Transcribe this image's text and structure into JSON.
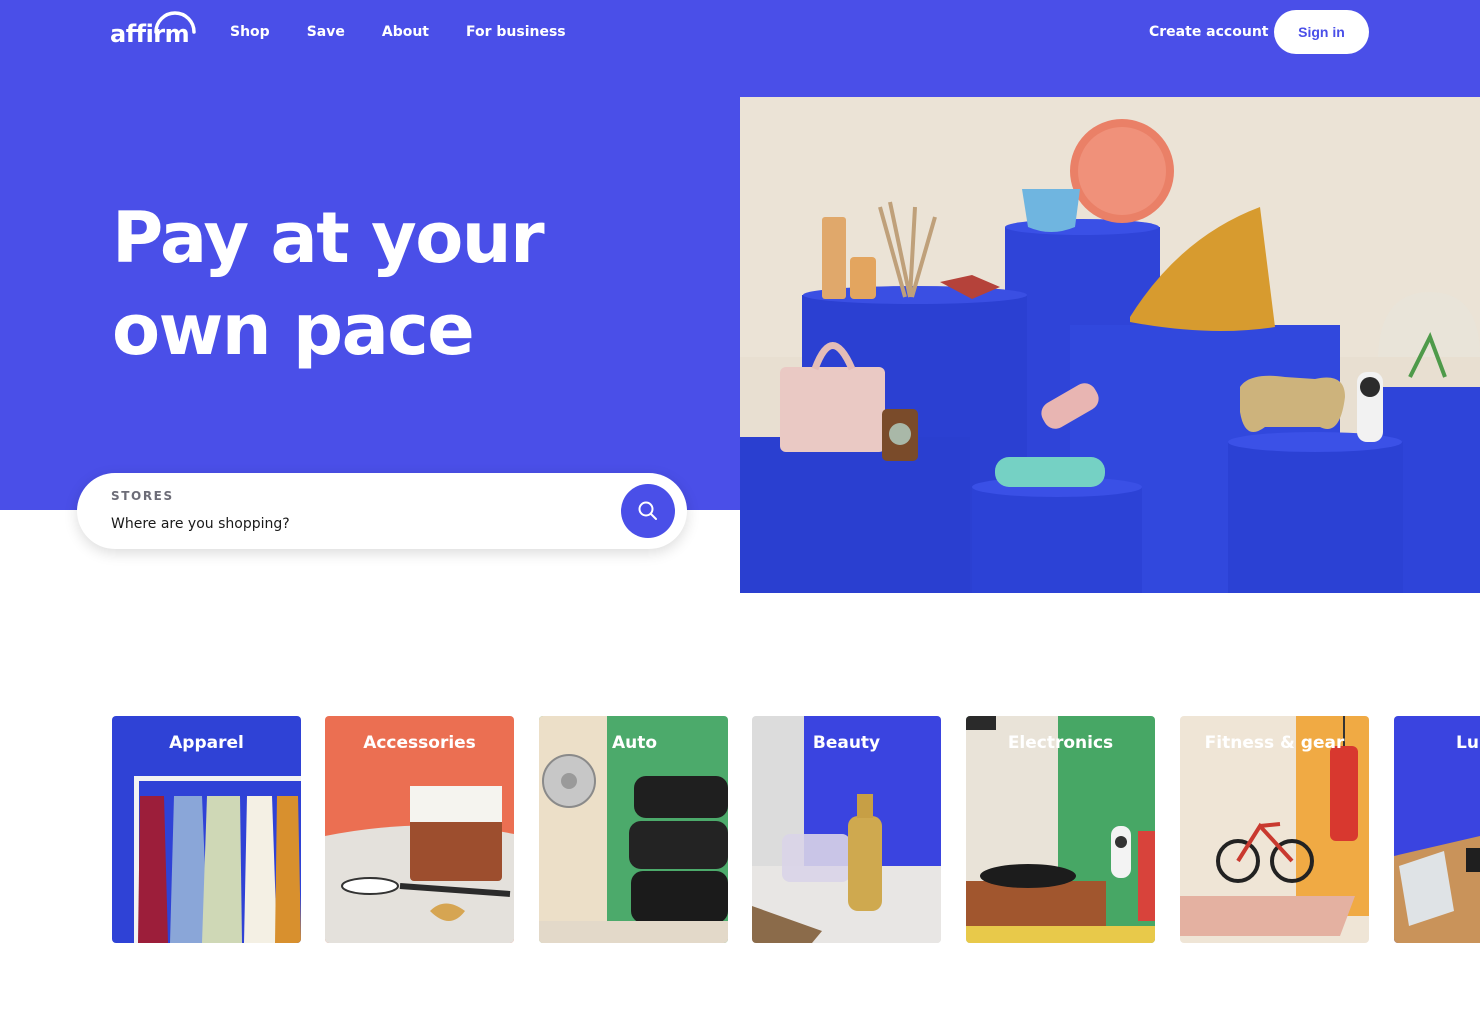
{
  "header": {
    "logo_text": "affirm",
    "nav": [
      "Shop",
      "Save",
      "About",
      "For business"
    ],
    "create_account": "Create account",
    "sign_in": "Sign in"
  },
  "hero": {
    "headline_line1": "Pay at your",
    "headline_line2": "own pace"
  },
  "search": {
    "label": "STORES",
    "placeholder": "Where are you shopping?"
  },
  "categories": [
    {
      "label": "Apparel"
    },
    {
      "label": "Accessories"
    },
    {
      "label": "Auto"
    },
    {
      "label": "Beauty"
    },
    {
      "label": "Electronics"
    },
    {
      "label": "Fitness & gear"
    },
    {
      "label": "Lu"
    }
  ],
  "colors": {
    "brand": "#4a4fe8",
    "white": "#ffffff"
  },
  "icons": [
    "search-icon"
  ]
}
